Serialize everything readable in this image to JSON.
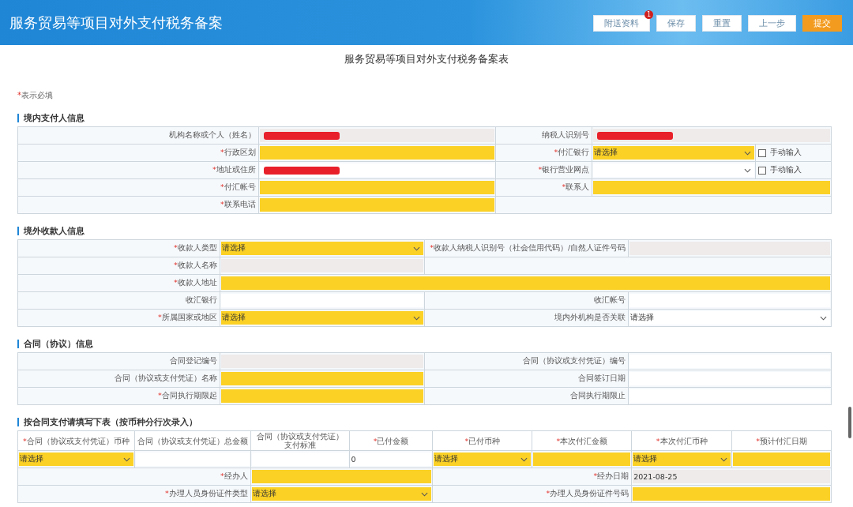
{
  "header": {
    "title": "服务贸易等项目对外支付税务备案",
    "buttons": [
      {
        "label": "附送资料",
        "kind": "default",
        "badge": "1"
      },
      {
        "label": "保存",
        "kind": "default"
      },
      {
        "label": "重置",
        "kind": "default"
      },
      {
        "label": "上一步",
        "kind": "default"
      },
      {
        "label": "提交",
        "kind": "primary"
      }
    ]
  },
  "form_title": "服务贸易等项目对外支付税务备案表",
  "required_note": {
    "mark": "*",
    "text": "表示必填"
  },
  "sections": [
    {
      "title": "境内支付人信息",
      "tables": [
        [
          [
            {
              "kind": "label",
              "text": "机构名称或个人（姓名）",
              "required": false
            },
            {
              "kind": "input",
              "highlighted": false,
              "readonly": true,
              "redacted": true
            },
            {
              "kind": "label",
              "text": "纳税人识别号",
              "required": false
            },
            {
              "kind": "input",
              "highlighted": false,
              "readonly": true,
              "redacted": true
            }
          ],
          [
            {
              "kind": "label",
              "text": "行政区划",
              "required": true
            },
            {
              "kind": "input",
              "highlighted": true,
              "readonly": false
            },
            {
              "kind": "label",
              "text": "付汇银行",
              "required": true
            },
            {
              "kind": "select",
              "highlighted": true,
              "readonly": false,
              "value": "请选择"
            },
            {
              "kind": "checkbox",
              "text": "手动输入",
              "checked": false
            }
          ],
          [
            {
              "kind": "label",
              "text": "地址或住所",
              "required": true
            },
            {
              "kind": "input",
              "highlighted": false,
              "readonly": false,
              "redacted": true
            },
            {
              "kind": "label",
              "text": "银行营业网点",
              "required": true
            },
            {
              "kind": "select",
              "highlighted": false,
              "readonly": false
            },
            {
              "kind": "checkbox",
              "text": "手动输入",
              "checked": false
            }
          ],
          [
            {
              "kind": "label",
              "text": "付汇帐号",
              "required": true
            },
            {
              "kind": "input",
              "highlighted": true,
              "readonly": false
            },
            {
              "kind": "label",
              "text": "联系人",
              "required": true
            },
            {
              "kind": "input",
              "highlighted": true,
              "readonly": false
            }
          ],
          [
            {
              "kind": "label",
              "text": "联系电话",
              "required": true
            },
            {
              "kind": "input",
              "highlighted": true,
              "readonly": false
            }
          ]
        ]
      ]
    },
    {
      "title": "境外收款人信息",
      "tables": [
        [
          [
            {
              "kind": "label",
              "text": "收款人类型",
              "required": true
            },
            {
              "kind": "select",
              "highlighted": true,
              "readonly": false,
              "value": "请选择"
            },
            {
              "kind": "label",
              "text": "收款人纳税人识别号（社会信用代码）/自然人证件号码",
              "required": true
            },
            {
              "kind": "input",
              "highlighted": false,
              "readonly": true
            }
          ],
          [
            {
              "kind": "label",
              "text": "收款人名称",
              "required": true
            },
            {
              "kind": "input",
              "highlighted": false,
              "readonly": true
            }
          ],
          [
            {
              "kind": "label",
              "text": "收款人地址",
              "required": true
            },
            {
              "kind": "input",
              "highlighted": true,
              "readonly": false
            }
          ],
          [
            {
              "kind": "label",
              "text": "收汇银行",
              "required": false
            },
            {
              "kind": "input",
              "highlighted": false,
              "readonly": false
            },
            {
              "kind": "label",
              "text": "收汇帐号",
              "required": false
            },
            {
              "kind": "input",
              "highlighted": false,
              "readonly": false
            }
          ],
          [
            {
              "kind": "label",
              "text": "所属国家或地区",
              "required": true
            },
            {
              "kind": "select",
              "highlighted": true,
              "readonly": false,
              "value": "请选择"
            },
            {
              "kind": "label",
              "text": "境内外机构是否关联",
              "required": false
            },
            {
              "kind": "select",
              "highlighted": false,
              "readonly": false,
              "value": "请选择"
            }
          ]
        ]
      ]
    },
    {
      "title": "合同（协议）信息",
      "tables": [
        [
          [
            {
              "kind": "label",
              "text": "合同登记编号",
              "required": false
            },
            {
              "kind": "input",
              "highlighted": false,
              "readonly": true
            },
            {
              "kind": "label",
              "text": "合同（协议或支付凭证）编号",
              "required": false
            },
            {
              "kind": "input",
              "highlighted": false,
              "readonly": false
            }
          ],
          [
            {
              "kind": "label",
              "text": "合同（协议或支付凭证）名称",
              "required": false
            },
            {
              "kind": "input",
              "highlighted": true,
              "readonly": false
            },
            {
              "kind": "label",
              "text": "合同签订日期",
              "required": false
            },
            {
              "kind": "input",
              "highlighted": false,
              "readonly": false
            }
          ],
          [
            {
              "kind": "label",
              "text": "合同执行期限起",
              "required": true
            },
            {
              "kind": "input",
              "highlighted": true,
              "readonly": false
            },
            {
              "kind": "label",
              "text": "合同执行期限止",
              "required": false
            },
            {
              "kind": "input",
              "highlighted": false,
              "readonly": false
            }
          ]
        ]
      ]
    },
    {
      "title": "按合同支付请填写下表（按币种分行次录入）",
      "tables": [
        [
          [
            {
              "kind": "header",
              "text": "合同（协议或支付凭证）币种",
              "required": true
            },
            {
              "kind": "header",
              "text": "合同（协议或支付凭证）总金额",
              "required": false
            },
            {
              "kind": "header",
              "text": "合同（协议或支付凭证）支付标准",
              "required": false
            },
            {
              "kind": "header",
              "text": "已付金额",
              "required": true
            },
            {
              "kind": "header",
              "text": "已付币种",
              "required": true
            },
            {
              "kind": "header",
              "text": "本次付汇金额",
              "required": true
            },
            {
              "kind": "header",
              "text": "本次付汇币种",
              "required": true
            },
            {
              "kind": "header",
              "text": "预计付汇日期",
              "required": true
            }
          ],
          [
            {
              "kind": "select",
              "highlighted": true,
              "readonly": false,
              "value": "请选择"
            },
            {
              "kind": "input",
              "highlighted": false,
              "readonly": false
            },
            {
              "kind": "input",
              "highlighted": false,
              "readonly": false
            },
            {
              "kind": "input",
              "highlighted": false,
              "readonly": false,
              "value": "0"
            },
            {
              "kind": "select",
              "highlighted": true,
              "readonly": false,
              "value": "请选择"
            },
            {
              "kind": "input",
              "highlighted": true,
              "readonly": false
            },
            {
              "kind": "select",
              "highlighted": true,
              "readonly": false,
              "value": "请选择"
            },
            {
              "kind": "input",
              "highlighted": true,
              "readonly": false
            }
          ]
        ],
        [
          [
            {
              "kind": "label",
              "text": "经办人",
              "required": true
            },
            {
              "kind": "input",
              "highlighted": true,
              "readonly": false
            },
            {
              "kind": "label",
              "text": "经办日期",
              "required": true
            },
            {
              "kind": "input",
              "highlighted": false,
              "readonly": true,
              "value": "2021-08-25"
            }
          ],
          [
            {
              "kind": "label",
              "text": "办理人员身份证件类型",
              "required": true
            },
            {
              "kind": "select",
              "highlighted": true,
              "readonly": false,
              "value": "请选择"
            },
            {
              "kind": "label",
              "text": "办理人员身份证件号码",
              "required": true
            },
            {
              "kind": "input",
              "highlighted": true,
              "readonly": false
            }
          ]
        ]
      ]
    }
  ]
}
